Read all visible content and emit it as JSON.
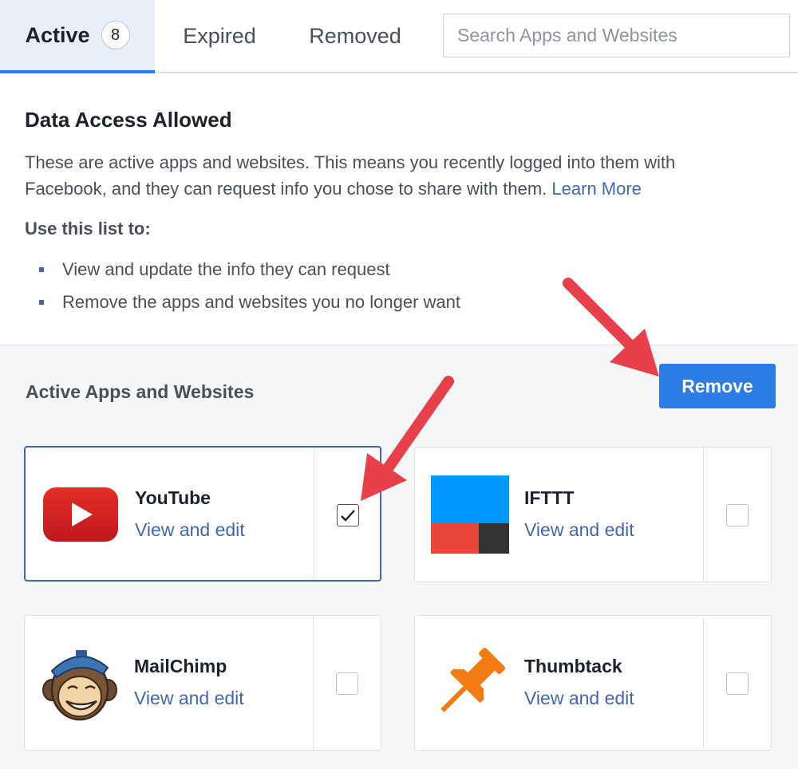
{
  "tabs": {
    "active_label": "Active",
    "active_count": "8",
    "expired_label": "Expired",
    "removed_label": "Removed"
  },
  "search": {
    "placeholder": "Search Apps and Websites",
    "value": ""
  },
  "info": {
    "title": "Data Access Allowed",
    "description": "These are active apps and websites. This means you recently logged into them with Facebook, and they can request info you chose to share with them.",
    "learn_more": "Learn More",
    "subtitle": "Use this list to:",
    "bullets": [
      "View and update the info they can request",
      "Remove the apps and websites you no longer want"
    ]
  },
  "apps": {
    "title": "Active Apps and Websites",
    "remove_label": "Remove",
    "items": [
      {
        "name": "YouTube",
        "link": "View and edit",
        "checked": true,
        "icon": "youtube-logo"
      },
      {
        "name": "IFTTT",
        "link": "View and edit",
        "checked": false,
        "icon": "ifttt-logo"
      },
      {
        "name": "MailChimp",
        "link": "View and edit",
        "checked": false,
        "icon": "mailchimp-logo"
      },
      {
        "name": "Thumbtack",
        "link": "View and edit",
        "checked": false,
        "icon": "thumbtack-logo"
      }
    ]
  },
  "colors": {
    "accent": "#2d7be4",
    "link": "#4267b2",
    "annotation_arrow": "#e8404a"
  }
}
